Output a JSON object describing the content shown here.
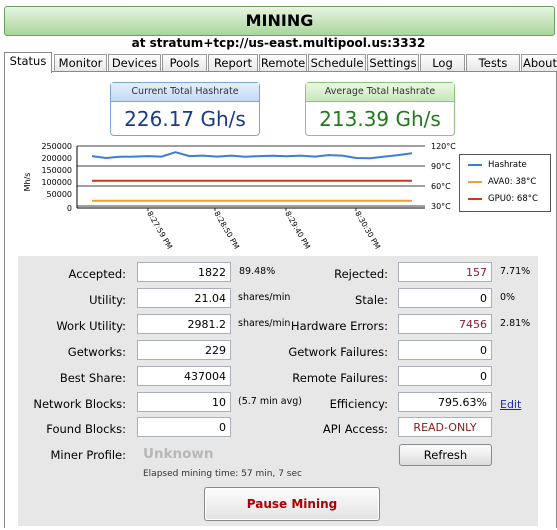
{
  "header": {
    "title": "MINING",
    "subtitle": "at stratum+tcp://us-east.multipool.us:3332"
  },
  "tabs": [
    "Status",
    "Monitor",
    "Devices",
    "Pools",
    "Report",
    "Remote",
    "Schedule",
    "Settings",
    "Log",
    "Tests",
    "About"
  ],
  "active_tab": "Status",
  "hashrate": {
    "current_title": "Current Total Hashrate",
    "current_value": "226.17 Gh/s",
    "average_title": "Average Total Hashrate",
    "average_value": "213.39 Gh/s"
  },
  "chart_data": {
    "type": "line",
    "ylabel": "Mh/s",
    "y_ticks": [
      "250000",
      "200000",
      "150000",
      "100000",
      "50000",
      "0"
    ],
    "y_range": [
      0,
      250000
    ],
    "temp_ticks": [
      "120°C",
      "90°C",
      "60°C",
      "30°C"
    ],
    "temp_range": [
      30,
      120
    ],
    "x_ticks": [
      "8:27:59 PM",
      "8:28:50 PM",
      "8:29:40 PM",
      "8:30:30 PM"
    ],
    "legend_position": "right",
    "series": [
      {
        "name": "Hashrate",
        "axis": "left",
        "color": "#3a7fd5",
        "values": [
          208000,
          200000,
          205000,
          206000,
          208000,
          206000,
          224000,
          208000,
          210000,
          206000,
          210000,
          205000,
          208000,
          209000,
          207000,
          210000,
          206000,
          212000,
          210000,
          200000,
          199000,
          206000,
          212000,
          220000
        ]
      },
      {
        "name": "AVA0: 38°C",
        "axis": "right",
        "color": "#f0a030",
        "values": [
          38,
          38,
          38,
          38,
          38,
          38,
          38,
          38,
          38,
          38,
          38,
          38,
          38,
          38,
          38,
          38,
          38,
          38,
          38,
          38,
          38,
          38,
          38,
          38
        ]
      },
      {
        "name": "GPU0: 68°C",
        "axis": "right",
        "color": "#c83a1a",
        "values": [
          68,
          68,
          68,
          68,
          68,
          68,
          68,
          68,
          68,
          68,
          68,
          68,
          68,
          68,
          68,
          68,
          68,
          68,
          68,
          68,
          68,
          68,
          68,
          68
        ]
      }
    ]
  },
  "stats": {
    "accepted": {
      "label": "Accepted:",
      "value": "1822",
      "unit": "89.48%"
    },
    "rejected": {
      "label": "Rejected:",
      "value": "157",
      "unit": "7.71%"
    },
    "utility": {
      "label": "Utility:",
      "value": "21.04",
      "unit": "shares/min"
    },
    "stale": {
      "label": "Stale:",
      "value": "0",
      "unit": "0%"
    },
    "work_utility": {
      "label": "Work Utility:",
      "value": "2981.2",
      "unit": "shares/min"
    },
    "hardware_errors": {
      "label": "Hardware Errors:",
      "value": "7456",
      "unit": "2.81%"
    },
    "getworks": {
      "label": "Getworks:",
      "value": "229"
    },
    "getwork_failures": {
      "label": "Getwork Failures:",
      "value": "0"
    },
    "best_share": {
      "label": "Best Share:",
      "value": "437004"
    },
    "remote_failures": {
      "label": "Remote Failures:",
      "value": "0"
    },
    "network_blocks": {
      "label": "Network Blocks:",
      "value": "10",
      "unit": "(5.7 min avg)"
    },
    "efficiency": {
      "label": "Efficiency:",
      "value": "795.63%",
      "link": "Edit"
    },
    "found_blocks": {
      "label": "Found Blocks:",
      "value": "0"
    },
    "api_access": {
      "label": "API Access:",
      "value": "READ-ONLY"
    },
    "miner_profile": {
      "label": "Miner Profile:",
      "value": "Unknown"
    }
  },
  "elapsed": "Elapsed mining time: 57 min, 7 sec",
  "buttons": {
    "refresh": "Refresh",
    "pause": "Pause Mining"
  },
  "colors": {
    "rejected": "#8a1a3a",
    "hardware_errors": "#8a1a3a",
    "api_access": "#8a1a1a",
    "pause_text": "#b00000"
  }
}
